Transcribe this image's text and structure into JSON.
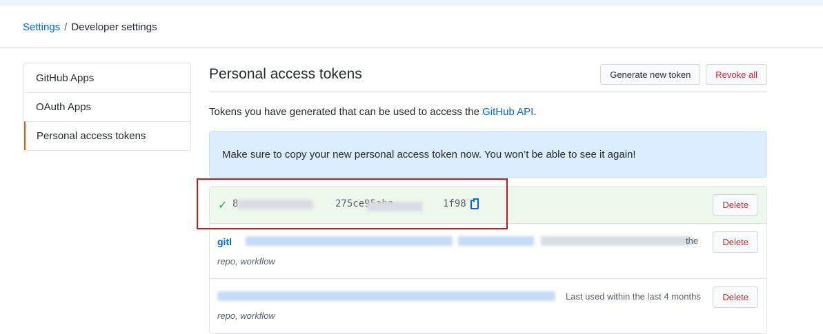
{
  "breadcrumb": {
    "settings": "Settings",
    "separator": "/",
    "current": "Developer settings"
  },
  "sidebar": {
    "items": [
      {
        "label": "GitHub Apps"
      },
      {
        "label": "OAuth Apps"
      },
      {
        "label": "Personal access tokens",
        "selected": true
      }
    ]
  },
  "main": {
    "title": "Personal access tokens",
    "generate_label": "Generate new token",
    "revoke_label": "Revoke all",
    "description_prefix": "Tokens you have generated that can be used to access the ",
    "description_link": "GitHub API",
    "description_suffix": ".",
    "flash": "Make sure to copy your new personal access token now. You won’t be able to see it again!"
  },
  "tokens": [
    {
      "value_start": "8",
      "value_mid": "275ce95aba",
      "value_end": "1f98",
      "delete_label": "Delete"
    },
    {
      "name": "gitl",
      "scopes": "repo, workflow",
      "last_used": "the",
      "delete_label": "Delete"
    },
    {
      "scopes": "repo, workflow",
      "last_used": "Last used within the last 4 months",
      "delete_label": "Delete"
    }
  ],
  "icons": {
    "check": "check-icon",
    "copy": "clipboard-icon"
  },
  "colors": {
    "link": "#0366d6",
    "danger": "#cb2431",
    "success": "#28a745",
    "flash_bg": "#dbedff",
    "new_token_bg": "#eef7ec",
    "annotation": "#d0121b"
  }
}
